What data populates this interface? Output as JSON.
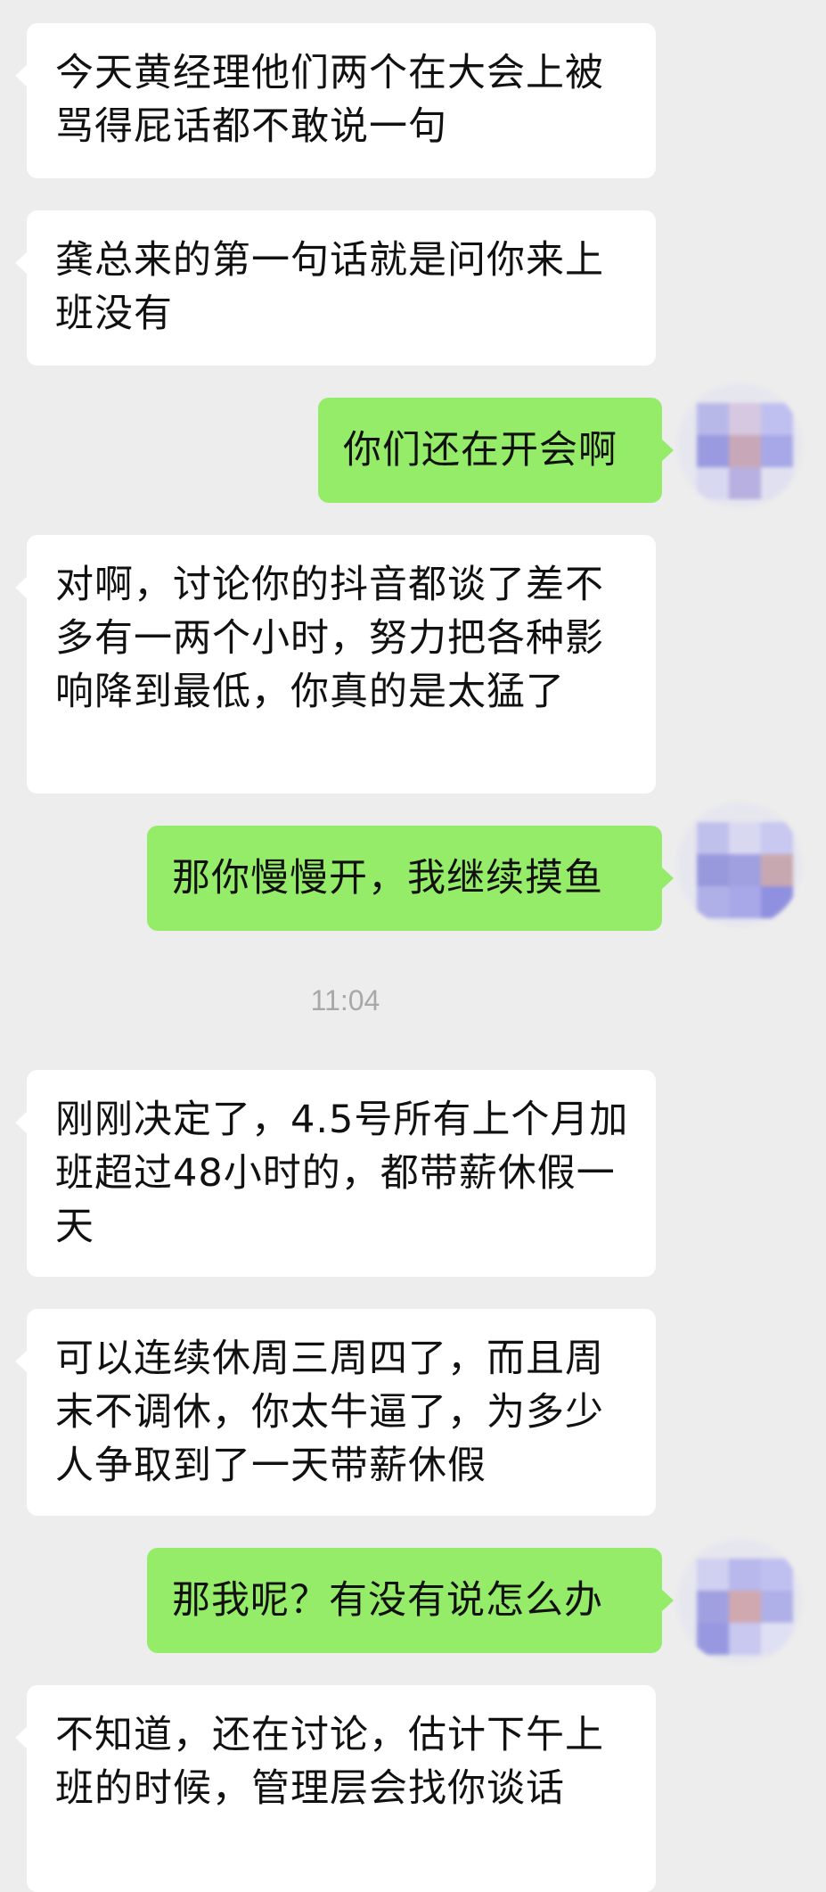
{
  "colors": {
    "background": "#ededed",
    "incoming_bubble": "#ffffff",
    "outgoing_bubble": "#95ec69",
    "timestamp_text": "#a8a8a8"
  },
  "messages": [
    {
      "direction": "incoming",
      "text": "今天黄经理他们两个在大会上被骂得屁话都不敢说一句"
    },
    {
      "direction": "incoming",
      "text": "龚总来的第一句话就是问你来上班没有"
    },
    {
      "direction": "outgoing",
      "text": "你们还在开会啊",
      "avatar": "blurred-avatar"
    },
    {
      "direction": "incoming",
      "text": "对啊，讨论你的抖音都谈了差不多有一两个小时，努力把各种影响降到最低，你真的是太猛了"
    },
    {
      "direction": "outgoing",
      "text": "那你慢慢开，我继续摸鱼",
      "avatar": "blurred-avatar"
    },
    {
      "type": "timestamp",
      "text": "11:04"
    },
    {
      "direction": "incoming",
      "text": "刚刚决定了，4.5号所有上个月加班超过48小时的，都带薪休假一天"
    },
    {
      "direction": "incoming",
      "text": "可以连续休周三周四了，而且周末不调休，你太牛逼了，为多少人争取到了一天带薪休假"
    },
    {
      "direction": "outgoing",
      "text": "那我呢？有没有说怎么办",
      "avatar": "blurred-avatar"
    },
    {
      "direction": "incoming",
      "text": "不知道，还在讨论，估计下午上班的时候，管理层会找你谈话"
    }
  ]
}
